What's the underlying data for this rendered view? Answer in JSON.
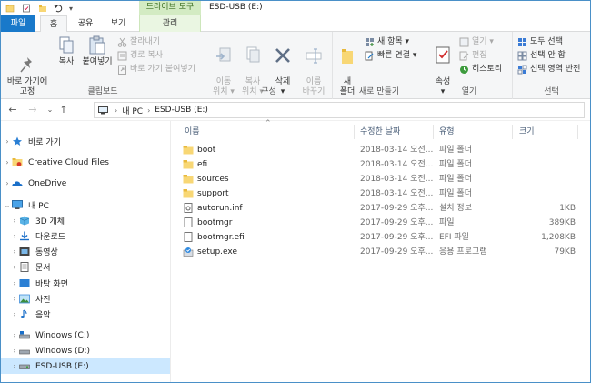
{
  "window": {
    "title": "ESD-USB (E:)",
    "context_group": "드라이브 도구"
  },
  "tabs": [
    {
      "label": "파일"
    },
    {
      "label": "홈"
    },
    {
      "label": "공유"
    },
    {
      "label": "보기"
    },
    {
      "label": "관리"
    }
  ],
  "ribbon": {
    "clipboard": {
      "label": "클립보드",
      "pin": "바로 가기에\n고정",
      "copy": "복사",
      "paste": "붙여넣기",
      "cut": "잘라내기",
      "copy_path": "경로 복사",
      "paste_shortcut": "바로 가기 붙여넣기"
    },
    "organize": {
      "label": "구성",
      "move_to": "이동\n위치 ▾",
      "copy_to": "복사\n위치 ▾",
      "delete": "삭제\n▾",
      "rename": "이름\n바꾸기"
    },
    "new": {
      "label": "새로 만들기",
      "new_folder": "새\n폴더",
      "new_item": "새 항목 ▾",
      "easy_access": "빠른 연결 ▾"
    },
    "open": {
      "label": "열기",
      "properties": "속성\n▾",
      "open": "열기 ▾",
      "edit": "편집",
      "history": "히스토리"
    },
    "select": {
      "label": "선택",
      "select_all": "모두 선택",
      "select_none": "선택 안 함",
      "invert": "선택 영역 반전"
    }
  },
  "address": {
    "segments": [
      "내 PC",
      "ESD-USB (E:)"
    ]
  },
  "nav": [
    {
      "label": "바로 가기",
      "icon": "star-icon"
    },
    {
      "label": "Creative Cloud Files",
      "icon": "creative-cloud-icon"
    },
    {
      "label": "OneDrive",
      "icon": "onedrive-icon"
    },
    {
      "label": "내 PC",
      "icon": "this-pc-icon"
    },
    {
      "label": "3D 개체",
      "icon": "3d-objects-icon"
    },
    {
      "label": "다운로드",
      "icon": "downloads-icon"
    },
    {
      "label": "동영상",
      "icon": "videos-icon"
    },
    {
      "label": "문서",
      "icon": "documents-icon"
    },
    {
      "label": "바탕 화면",
      "icon": "desktop-icon"
    },
    {
      "label": "사진",
      "icon": "pictures-icon"
    },
    {
      "label": "음악",
      "icon": "music-icon"
    },
    {
      "label": "Windows (C:)",
      "icon": "drive-icon"
    },
    {
      "label": "Windows (D:)",
      "icon": "drive-icon"
    },
    {
      "label": "ESD-USB (E:)",
      "icon": "usb-drive-icon"
    }
  ],
  "columns": {
    "name": "이름",
    "date": "수정한 날짜",
    "type": "유형",
    "size": "크기"
  },
  "files": [
    {
      "name": "boot",
      "date": "2018-03-14 오전...",
      "type": "파일 폴더",
      "size": "",
      "kind": "folder"
    },
    {
      "name": "efi",
      "date": "2018-03-14 오전...",
      "type": "파일 폴더",
      "size": "",
      "kind": "folder"
    },
    {
      "name": "sources",
      "date": "2018-03-14 오전...",
      "type": "파일 폴더",
      "size": "",
      "kind": "folder"
    },
    {
      "name": "support",
      "date": "2018-03-14 오전...",
      "type": "파일 폴더",
      "size": "",
      "kind": "folder"
    },
    {
      "name": "autorun.inf",
      "date": "2017-09-29 오후...",
      "type": "설치 정보",
      "size": "1KB",
      "kind": "settings"
    },
    {
      "name": "bootmgr",
      "date": "2017-09-29 오후...",
      "type": "파일",
      "size": "389KB",
      "kind": "file"
    },
    {
      "name": "bootmgr.efi",
      "date": "2017-09-29 오후...",
      "type": "EFI 파일",
      "size": "1,208KB",
      "kind": "file"
    },
    {
      "name": "setup.exe",
      "date": "2017-09-29 오후...",
      "type": "응용 프로그램",
      "size": "79KB",
      "kind": "setup"
    }
  ],
  "colors": {
    "accent": "#1979ca",
    "selection": "#cce8ff",
    "context_tab": "#d3ebc3",
    "folder": "#f8d775"
  }
}
